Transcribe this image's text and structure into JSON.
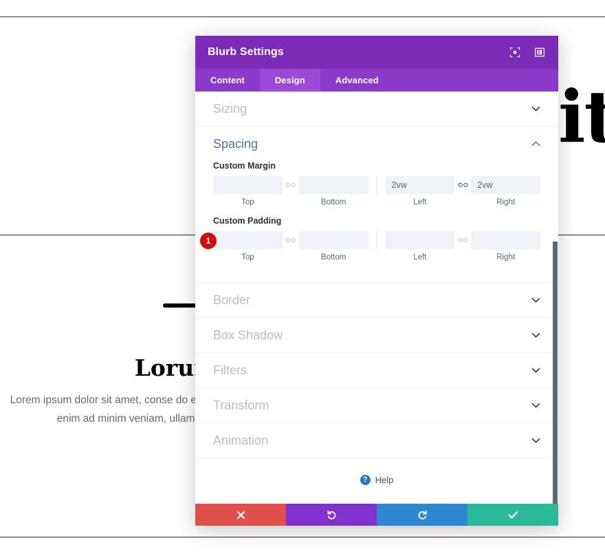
{
  "background": {
    "big_text": "it",
    "heading": "Lorum ip",
    "paragraph": "Lorem ipsum dolor sit amet, conse do eiusmod tempor incididunt ut aliqua. Ut enim ad minim veniam, ullamco laboris nisi ut aliquip ex e"
  },
  "modal": {
    "title": "Blurb Settings",
    "header_icons": [
      {
        "name": "focus-icon",
        "label": "Focus"
      },
      {
        "name": "layout-icon",
        "label": "Layout"
      }
    ],
    "tabs": [
      {
        "label": "Content",
        "active": false
      },
      {
        "label": "Design",
        "active": true
      },
      {
        "label": "Advanced",
        "active": false
      }
    ],
    "sections": [
      {
        "label": "Sizing",
        "open": false
      },
      {
        "label": "Spacing",
        "open": true
      },
      {
        "label": "Border",
        "open": false
      },
      {
        "label": "Box Shadow",
        "open": false
      },
      {
        "label": "Filters",
        "open": false
      },
      {
        "label": "Transform",
        "open": false
      },
      {
        "label": "Animation",
        "open": false
      }
    ],
    "spacing": {
      "margin": {
        "label": "Custom Margin",
        "top": {
          "value": "",
          "placeholder": "",
          "caption": "Top"
        },
        "bottom": {
          "value": "",
          "placeholder": "",
          "caption": "Bottom"
        },
        "left": {
          "value": "2vw",
          "placeholder": "",
          "caption": "Left"
        },
        "right": {
          "value": "2vw",
          "placeholder": "",
          "caption": "Right"
        },
        "link_tb": "unlinked",
        "link_lr": "linked"
      },
      "padding": {
        "label": "Custom Padding",
        "top": {
          "value": "",
          "placeholder": "",
          "caption": "Top"
        },
        "bottom": {
          "value": "",
          "placeholder": "",
          "caption": "Bottom"
        },
        "left": {
          "value": "",
          "placeholder": "",
          "caption": "Left"
        },
        "right": {
          "value": "",
          "placeholder": "",
          "caption": "Right"
        },
        "link_tb": "unlinked",
        "link_lr": "unlinked"
      }
    },
    "badge": {
      "number": "1"
    },
    "help": {
      "label": "Help",
      "icon_glyph": "?"
    },
    "footer": [
      {
        "name": "cancel-button",
        "icon": "times-icon",
        "color": "#e0504a"
      },
      {
        "name": "undo-button",
        "icon": "undo-icon",
        "color": "#7f30cd"
      },
      {
        "name": "redo-button",
        "icon": "redo-icon",
        "color": "#2f87cf"
      },
      {
        "name": "save-button",
        "icon": "check-icon",
        "color": "#2cb99a"
      }
    ]
  },
  "colors": {
    "header_purple": "#7b2bb5",
    "tabs_purple": "#8A39C9",
    "tab_active_purple": "#9a4ad6",
    "section_open_blue": "#4c7a9b",
    "link_active_blue": "#3a87c8",
    "badge_red": "#d10d12"
  }
}
